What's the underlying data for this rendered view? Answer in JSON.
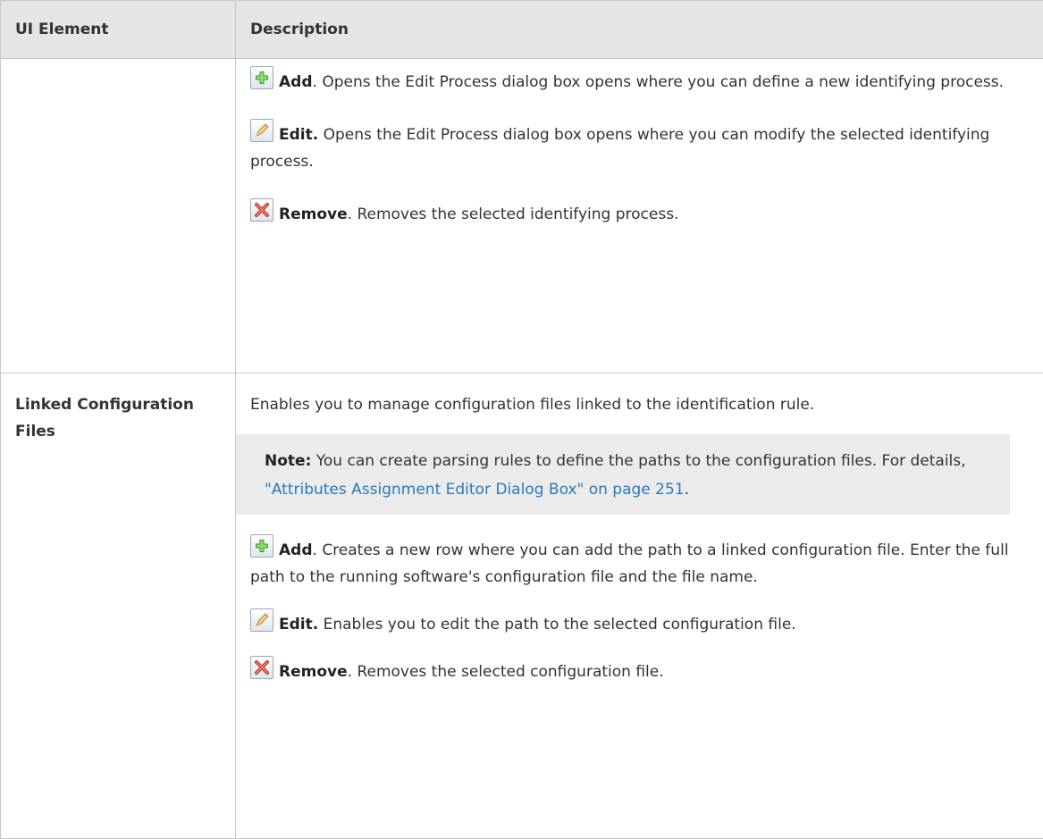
{
  "table": {
    "headers": [
      "UI Element",
      "Description"
    ],
    "row1": {
      "name": "",
      "items": [
        {
          "icon": "add-icon",
          "label": "Add",
          "sep": ". ",
          "text": "Opens the Edit Process dialog box opens where you can define a new identifying process."
        },
        {
          "icon": "edit-icon",
          "label": "Edit.",
          "sep": " ",
          "text": "Opens the Edit Process dialog box opens where you can modify the selected identifying process."
        },
        {
          "icon": "remove-icon",
          "label": "Remove",
          "sep": ". ",
          "text": "Removes the selected identifying process."
        }
      ]
    },
    "row2": {
      "name": "Linked Configuration Files",
      "intro": "Enables you to manage configuration files linked to the identification rule.",
      "note": {
        "label": "Note:",
        "text": " You can create parsing rules to define the paths to the configuration files. For details, ",
        "link": "\"Attributes Assignment Editor Dialog Box\" on page 251",
        "end": "."
      },
      "items": [
        {
          "icon": "add-icon",
          "label": "Add",
          "sep": ". ",
          "text": "Creates a new row where you can add the path to a linked configuration file. Enter the full path to the running software's configuration file and the file name."
        },
        {
          "icon": "edit-icon",
          "label": "Edit.",
          "sep": " ",
          "text": "Enables you to edit the path to the selected configuration file."
        },
        {
          "icon": "remove-icon",
          "label": "Remove",
          "sep": ". ",
          "text": "Removes the selected configuration file."
        }
      ]
    }
  },
  "colors": {
    "header_bg": "#e5e5e5",
    "note_bg": "#ebebeb",
    "link": "#2a7ab8",
    "border": "#c8c8c8"
  }
}
